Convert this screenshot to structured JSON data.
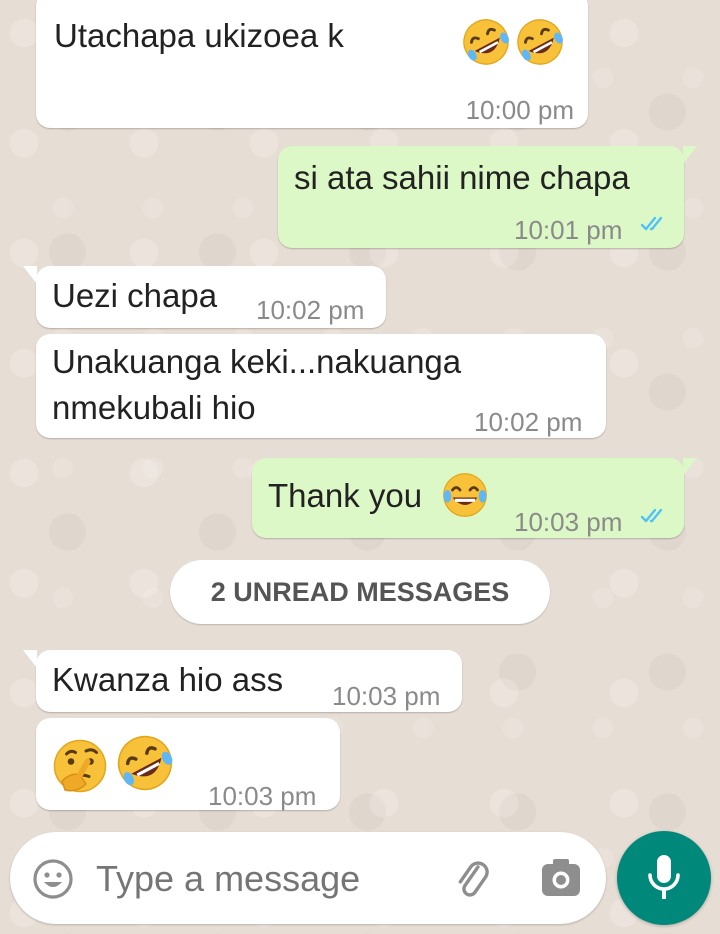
{
  "messages": [
    {
      "id": "m1",
      "direction": "incoming",
      "text": "Utachapa ukizoea k",
      "time": "10:00 pm",
      "emoji": [
        "rolling-on-floor-laughing",
        "rolling-on-floor-laughing"
      ]
    },
    {
      "id": "m2",
      "direction": "outgoing",
      "text": "si ata sahii nime chapa",
      "time": "10:01 pm",
      "status": "read"
    },
    {
      "id": "m3",
      "direction": "incoming",
      "text": "Uezi chapa",
      "time": "10:02 pm"
    },
    {
      "id": "m4",
      "direction": "incoming",
      "lines": [
        "Unakuanga keki...nakuanga",
        "nmekubali hio"
      ],
      "time": "10:02 pm"
    },
    {
      "id": "m5",
      "direction": "outgoing",
      "text": "Thank you",
      "time": "10:03 pm",
      "status": "read",
      "emoji": [
        "face-with-tears-of-joy"
      ]
    },
    {
      "id": "m6",
      "direction": "incoming",
      "text": "Kwanza hio ass",
      "time": "10:03 pm"
    },
    {
      "id": "m7",
      "direction": "incoming",
      "text": "",
      "time": "10:03 pm",
      "emoji": [
        "thinking-face",
        "rolling-on-floor-laughing"
      ]
    }
  ],
  "unread_divider": "2 UNREAD MESSAGES",
  "composer": {
    "placeholder": "Type a message",
    "icons": [
      "emoji-icon",
      "attach-icon",
      "camera-icon",
      "mic-icon"
    ]
  },
  "colors": {
    "wallpaper": "#e6ddd4",
    "incoming_bubble": "#ffffff",
    "outgoing_bubble": "#dcf8c6",
    "read_ticks": "#4fc3f7",
    "mic_button": "#00897b"
  }
}
